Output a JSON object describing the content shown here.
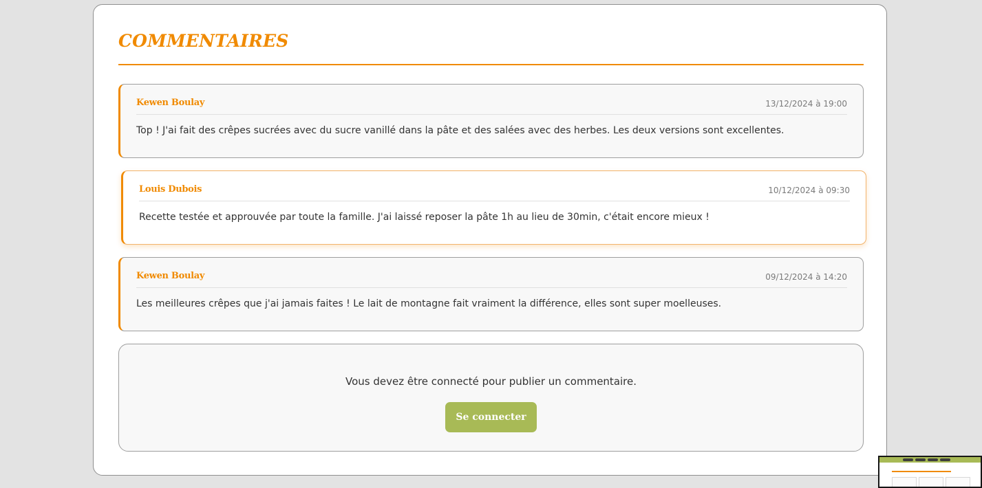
{
  "section": {
    "title": "Commentaires"
  },
  "comments": [
    {
      "author": "Kewen Boulay",
      "date": "13/12/2024 à 19:00",
      "text": "Top ! J'ai fait des crêpes sucrées avec du sucre vanillé dans la pâte et des salées avec des herbes. Les deux versions sont excellentes."
    },
    {
      "author": "Louis Dubois",
      "date": "10/12/2024 à 09:30",
      "text": "Recette testée et approuvée par toute la famille. J'ai laissé reposer la pâte 1h au lieu de 30min, c'était encore mieux !"
    },
    {
      "author": "Kewen Boulay",
      "date": "09/12/2024 à 14:20",
      "text": "Les meilleures crêpes que j'ai jamais faites ! Le lait de montagne fait vraiment la différence, elles sont super moelleuses."
    }
  ],
  "login_prompt": {
    "message": "Vous devez être connecté pour publier un commentaire.",
    "button_label": "Se connecter"
  },
  "colors": {
    "accent": "#f08a00",
    "button": "#a8ba56",
    "page_background": "#e3e3e3",
    "card_background": "#ffffff"
  }
}
